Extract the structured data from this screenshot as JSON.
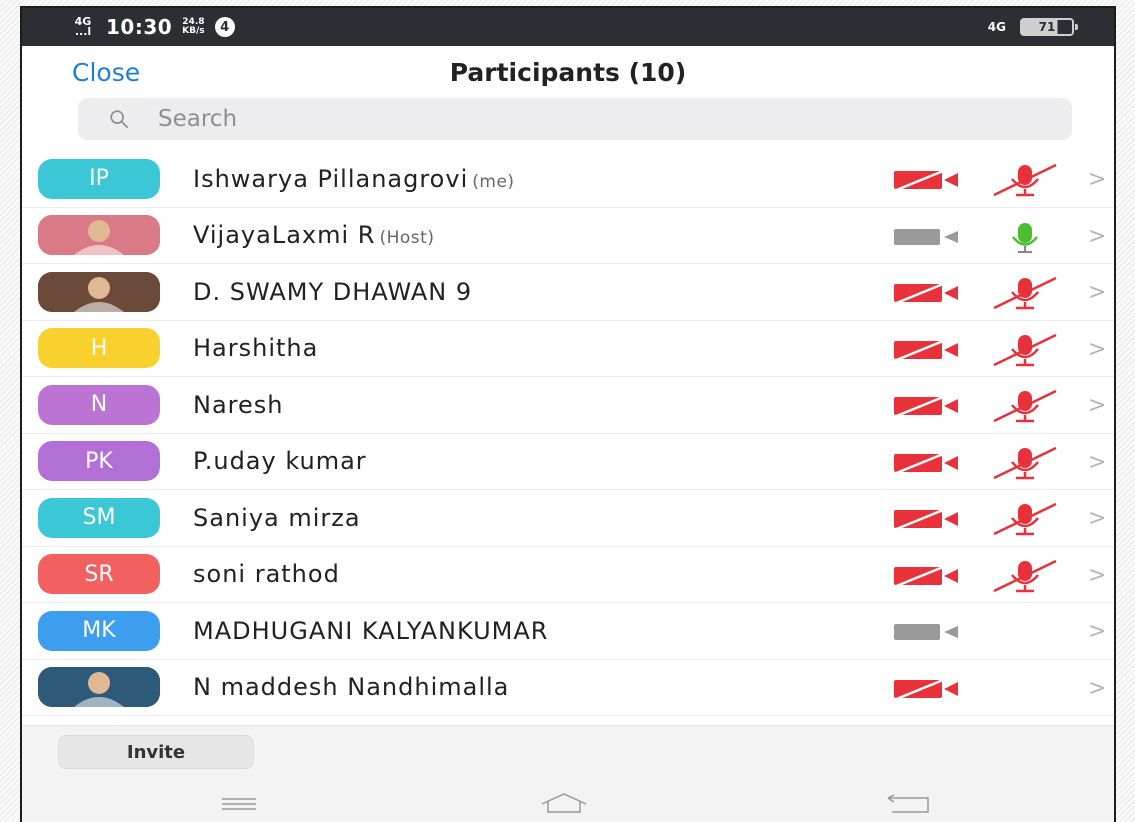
{
  "status_bar": {
    "network_top": "4G",
    "network_bottom": "...l",
    "time": "10:30",
    "speed_value": "24.8",
    "speed_unit": "KB/s",
    "notification_count": "4",
    "network_right": "4G",
    "battery": "71"
  },
  "header": {
    "close_label": "Close",
    "title": "Participants (10)"
  },
  "search": {
    "placeholder": "Search"
  },
  "colors": {
    "accent": "#1f7fd8",
    "muted_red": "#e8313a",
    "mic_on": "#4cbf30",
    "video_off_gray": "#9a9a9a"
  },
  "participants": [
    {
      "initials": "IP",
      "avatar_color": "#3cc7d6",
      "name": "Ishwarya Pillanagrovi",
      "tag": "(me)",
      "video": "off",
      "audio": "muted"
    },
    {
      "initials": "",
      "avatar_color": "#d97a86",
      "name": "VijayaLaxmi R",
      "tag": "(Host)",
      "video": "stopped",
      "audio": "on"
    },
    {
      "initials": "",
      "avatar_color": "#6b4a3a",
      "name": "D. SWAMY DHAWAN 9",
      "tag": "",
      "video": "off",
      "audio": "muted"
    },
    {
      "initials": "H",
      "avatar_color": "#f9d12f",
      "name": "Harshitha",
      "tag": "",
      "video": "off",
      "audio": "muted"
    },
    {
      "initials": "N",
      "avatar_color": "#bb74d4",
      "name": "Naresh",
      "tag": "",
      "video": "off",
      "audio": "muted"
    },
    {
      "initials": "PK",
      "avatar_color": "#b26fd6",
      "name": "P.uday kumar",
      "tag": "",
      "video": "off",
      "audio": "muted"
    },
    {
      "initials": "SM",
      "avatar_color": "#3cc7d6",
      "name": "Saniya mirza",
      "tag": "",
      "video": "off",
      "audio": "muted"
    },
    {
      "initials": "SR",
      "avatar_color": "#f26060",
      "name": "soni rathod",
      "tag": "",
      "video": "off",
      "audio": "muted"
    },
    {
      "initials": "MK",
      "avatar_color": "#3d9ef0",
      "name": "MADHUGANI KALYANKUMAR",
      "tag": "",
      "video": "stopped",
      "audio": "none"
    },
    {
      "initials": "",
      "avatar_color": "#2e5a7a",
      "name": "N maddesh Nandhimalla",
      "tag": "",
      "video": "off",
      "audio": "none"
    }
  ],
  "footer": {
    "invite_label": "Invite"
  }
}
